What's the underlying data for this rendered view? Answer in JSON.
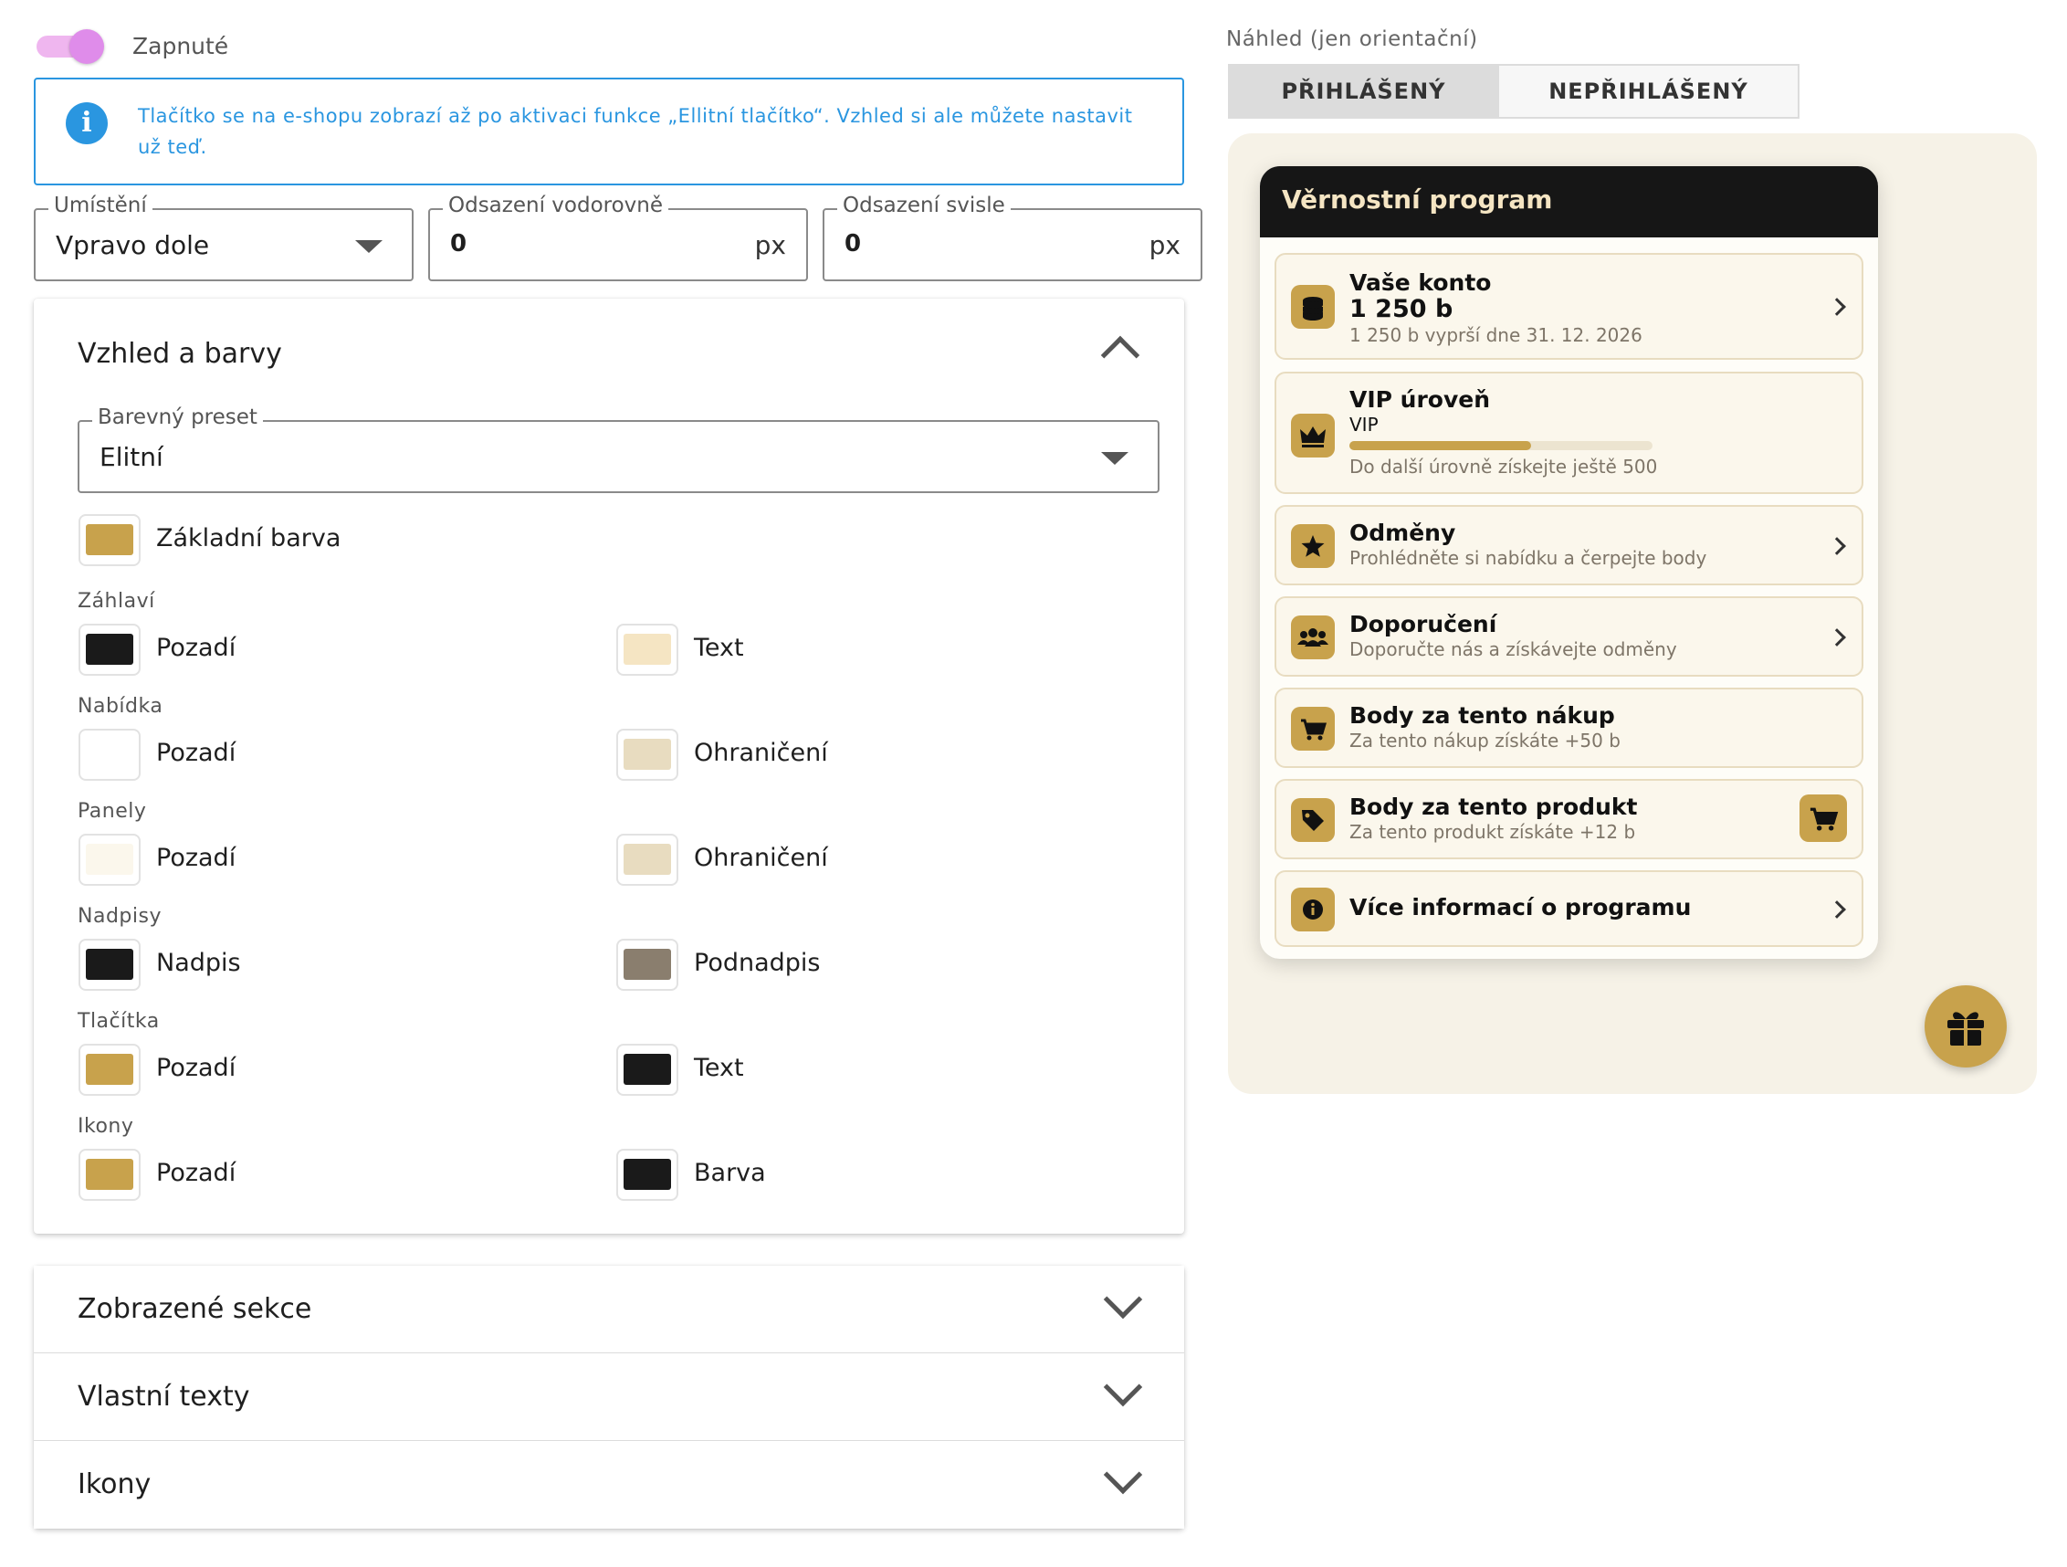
{
  "toggle": {
    "label": "Zapnuté"
  },
  "info": {
    "text": "Tlačítko se na e-shopu zobrazí až po aktivaci funkce „Ellitní tlačítko“. Vzhled si ale můžete nastavit už teď.",
    "icon": "info-icon"
  },
  "fields": {
    "position": {
      "label": "Umístění",
      "value": "Vpravo dole"
    },
    "offset_h": {
      "label": "Odsazení vodorovně",
      "value": "0",
      "unit": "px"
    },
    "offset_v": {
      "label": "Odsazení svisle",
      "value": "0",
      "unit": "px"
    }
  },
  "appearance": {
    "title": "Vzhled a barvy",
    "preset": {
      "label": "Barevný preset",
      "value": "Elitní"
    },
    "base_color": {
      "label": "Základní barva",
      "color": "#c8a24c"
    },
    "groups": [
      {
        "label": "Záhlaví",
        "items": [
          {
            "label": "Pozadí",
            "color": "#1a1a1a"
          },
          {
            "label": "Text",
            "color": "#f5e5c3"
          }
        ]
      },
      {
        "label": "Nabídka",
        "items": [
          {
            "label": "Pozadí",
            "color": "#ffffff"
          },
          {
            "label": "Ohraničení",
            "color": "#e8dcc0"
          }
        ]
      },
      {
        "label": "Panely",
        "items": [
          {
            "label": "Pozadí",
            "color": "#fbf7ec"
          },
          {
            "label": "Ohraničení",
            "color": "#e8dcc0"
          }
        ]
      },
      {
        "label": "Nadpisy",
        "items": [
          {
            "label": "Nadpis",
            "color": "#1a1a1a"
          },
          {
            "label": "Podnadpis",
            "color": "#8a7e6e"
          }
        ]
      },
      {
        "label": "Tlačítka",
        "items": [
          {
            "label": "Pozadí",
            "color": "#c8a24c"
          },
          {
            "label": "Text",
            "color": "#1a1a1a"
          }
        ]
      },
      {
        "label": "Ikony",
        "items": [
          {
            "label": "Pozadí",
            "color": "#c8a24c"
          },
          {
            "label": "Barva",
            "color": "#1a1a1a"
          }
        ]
      }
    ]
  },
  "sections": [
    {
      "title": "Zobrazené sekce"
    },
    {
      "title": "Vlastní texty"
    },
    {
      "title": "Ikony"
    }
  ],
  "preview": {
    "label": "Náhled (jen orientační)",
    "tabs": [
      {
        "label": "PŘIHLÁŠENÝ",
        "active": true
      },
      {
        "label": "NEPŘIHLÁŠENÝ",
        "active": false
      }
    ],
    "widget": {
      "title": "Věrnostní program",
      "account": {
        "title": "Vaše konto",
        "points": "1 250 b",
        "sub": "1 250 b vyprší dne 31. 12. 2026"
      },
      "vip": {
        "title": "VIP úroveň",
        "level": "VIP",
        "progress": 0.6,
        "sub": "Do další úrovně získejte ještě 500"
      },
      "rewards": {
        "title": "Odměny",
        "sub": "Prohlédněte si nabídku a čerpejte body"
      },
      "referral": {
        "title": "Doporučení",
        "sub": "Doporučte nás a získávejte odměny"
      },
      "purchase": {
        "title": "Body za tento nákup",
        "sub": "Za tento nákup získáte +50 b"
      },
      "product": {
        "title": "Body za tento produkt",
        "sub": "Za tento produkt získáte +12 b"
      },
      "info": {
        "title": "Více informací o programu"
      }
    },
    "fab_icon": "gift-icon"
  }
}
